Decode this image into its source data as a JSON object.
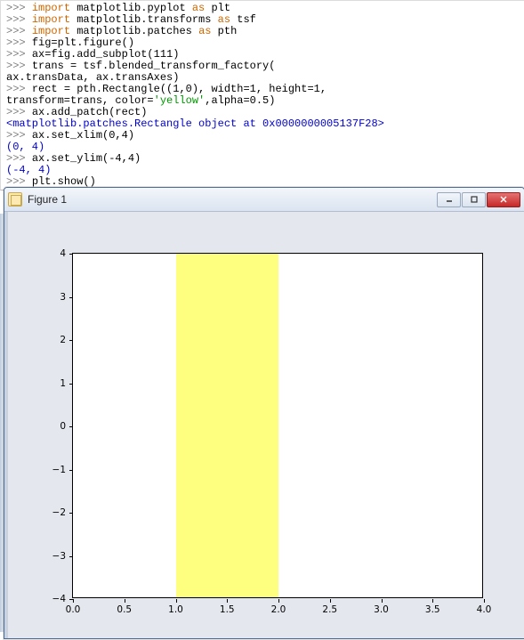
{
  "code": {
    "lines": [
      {
        "tokens": [
          {
            "c": "tok-prompt",
            "t": ">>> "
          },
          {
            "c": "tok-kw",
            "t": "import"
          },
          {
            "c": "tok-plain",
            "t": " matplotlib.pyplot "
          },
          {
            "c": "tok-kw",
            "t": "as"
          },
          {
            "c": "tok-plain",
            "t": " plt"
          }
        ]
      },
      {
        "tokens": [
          {
            "c": "tok-prompt",
            "t": ">>> "
          },
          {
            "c": "tok-kw",
            "t": "import"
          },
          {
            "c": "tok-plain",
            "t": " matplotlib.transforms "
          },
          {
            "c": "tok-kw",
            "t": "as"
          },
          {
            "c": "tok-plain",
            "t": " tsf"
          }
        ]
      },
      {
        "tokens": [
          {
            "c": "tok-prompt",
            "t": ">>> "
          },
          {
            "c": "tok-kw",
            "t": "import"
          },
          {
            "c": "tok-plain",
            "t": " matplotlib.patches "
          },
          {
            "c": "tok-kw",
            "t": "as"
          },
          {
            "c": "tok-plain",
            "t": " pth"
          }
        ]
      },
      {
        "tokens": [
          {
            "c": "tok-prompt",
            "t": ">>> "
          },
          {
            "c": "tok-plain",
            "t": "fig=plt.figure()"
          }
        ]
      },
      {
        "tokens": [
          {
            "c": "tok-prompt",
            "t": ">>> "
          },
          {
            "c": "tok-plain",
            "t": "ax=fig.add_subplot(111)"
          }
        ]
      },
      {
        "tokens": [
          {
            "c": "tok-prompt",
            "t": ">>> "
          },
          {
            "c": "tok-plain",
            "t": "trans = tsf.blended_transform_factory("
          }
        ]
      },
      {
        "tokens": [
          {
            "c": "tok-plain",
            "t": "ax.transData, ax.transAxes)"
          }
        ]
      },
      {
        "tokens": [
          {
            "c": "tok-prompt",
            "t": ">>> "
          },
          {
            "c": "tok-plain",
            "t": "rect = pth.Rectangle((1,0), width=1, height=1,"
          }
        ]
      },
      {
        "tokens": [
          {
            "c": "tok-plain",
            "t": "transform=trans, color="
          },
          {
            "c": "tok-str",
            "t": "'yellow'"
          },
          {
            "c": "tok-plain",
            "t": ",alpha=0.5)"
          }
        ]
      },
      {
        "tokens": [
          {
            "c": "tok-prompt",
            "t": ">>> "
          },
          {
            "c": "tok-plain",
            "t": "ax.add_patch(rect)"
          }
        ]
      },
      {
        "tokens": [
          {
            "c": "tok-out",
            "t": "<matplotlib.patches.Rectangle object at 0x0000000005137F28>"
          }
        ]
      },
      {
        "tokens": [
          {
            "c": "tok-prompt",
            "t": ">>> "
          },
          {
            "c": "tok-plain",
            "t": "ax.set_xlim(0,4)"
          }
        ]
      },
      {
        "tokens": [
          {
            "c": "tok-out",
            "t": "(0, 4)"
          }
        ]
      },
      {
        "tokens": [
          {
            "c": "tok-prompt",
            "t": ">>> "
          },
          {
            "c": "tok-plain",
            "t": "ax.set_ylim(-4,4)"
          }
        ]
      },
      {
        "tokens": [
          {
            "c": "tok-out",
            "t": "(-4, 4)"
          }
        ]
      },
      {
        "tokens": [
          {
            "c": "tok-prompt",
            "t": ">>> "
          },
          {
            "c": "tok-plain",
            "t": "plt.show()"
          }
        ]
      }
    ]
  },
  "window": {
    "title": "Figure 1"
  },
  "chart_data": {
    "type": "area",
    "title": "",
    "xlabel": "",
    "ylabel": "",
    "xlim": [
      0.0,
      4.0
    ],
    "ylim": [
      -4,
      4
    ],
    "x_ticks": [
      0.0,
      0.5,
      1.0,
      1.5,
      2.0,
      2.5,
      3.0,
      3.5,
      4.0
    ],
    "x_tick_labels": [
      "0.0",
      "0.5",
      "1.0",
      "1.5",
      "2.0",
      "2.5",
      "3.0",
      "3.5",
      "4.0"
    ],
    "y_ticks": [
      -4,
      -3,
      -2,
      -1,
      0,
      1,
      2,
      3,
      4
    ],
    "y_tick_labels": [
      "−4",
      "−3",
      "−2",
      "−1",
      "0",
      "1",
      "2",
      "3",
      "4"
    ],
    "rect": {
      "x0": 1.0,
      "x1": 2.0,
      "y0": -4,
      "y1": 4,
      "color": "#ffff00",
      "alpha": 0.5
    }
  }
}
